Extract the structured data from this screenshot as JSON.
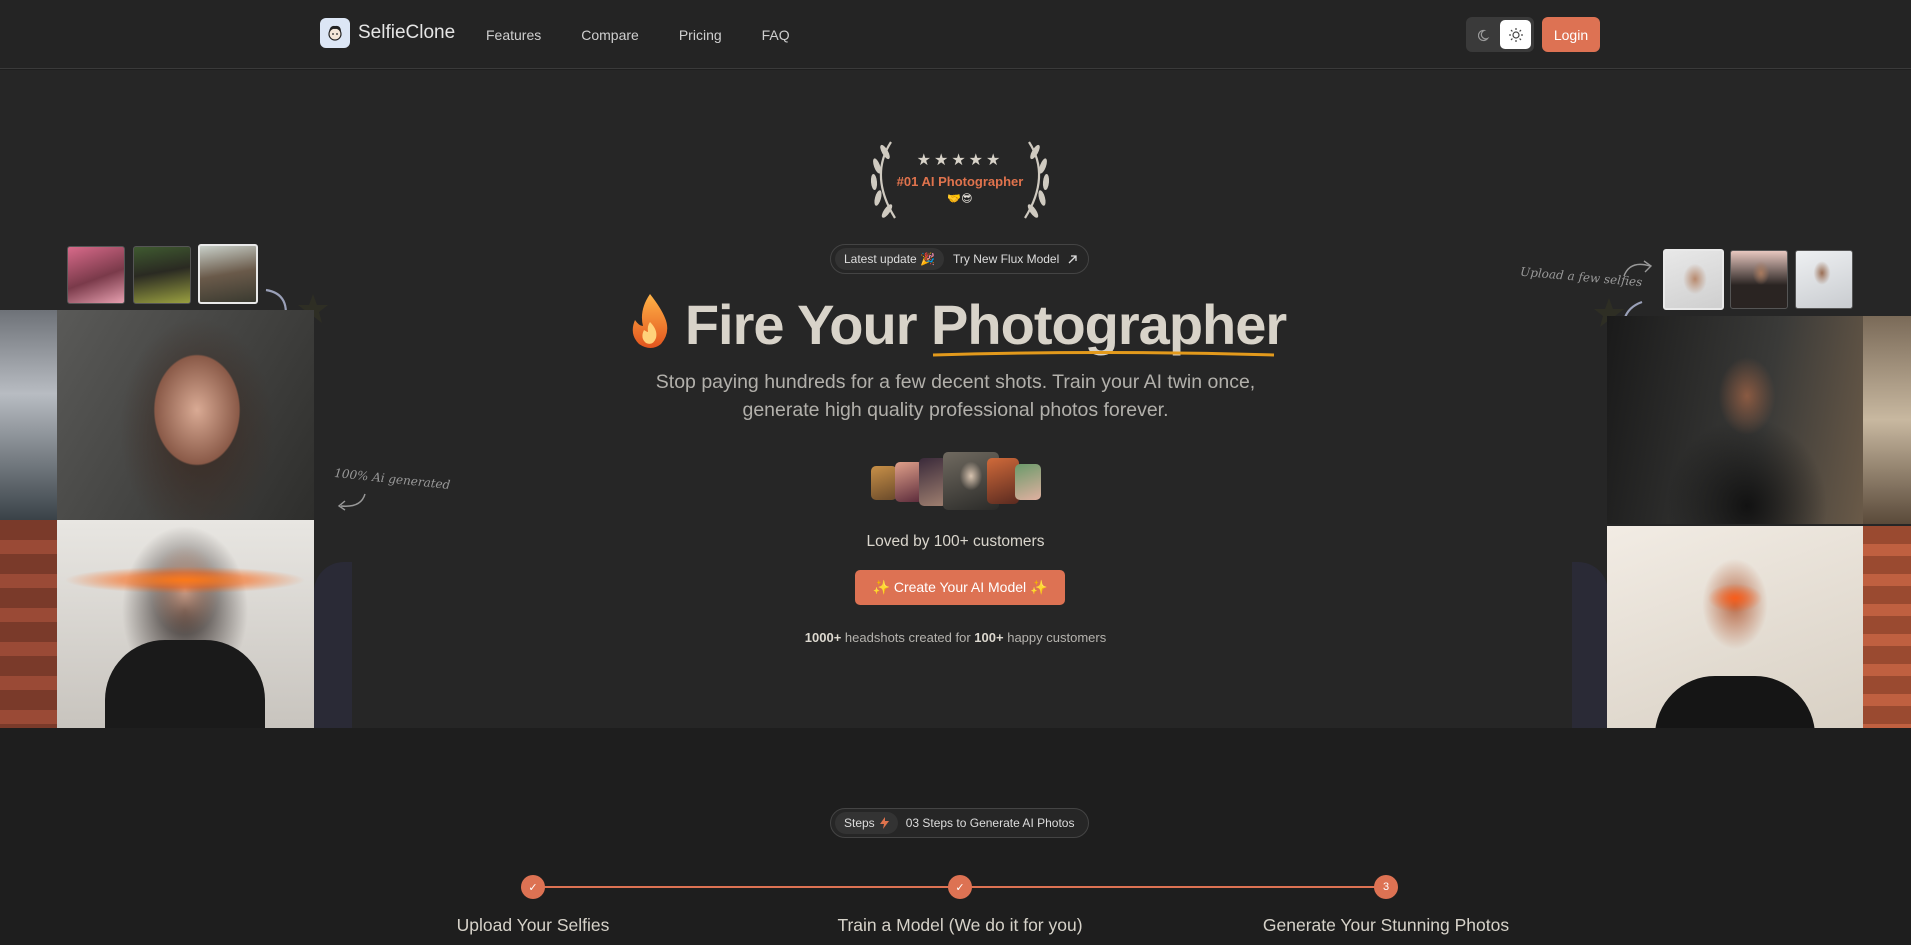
{
  "nav": {
    "brand": "SelfieClone",
    "links": [
      "Features",
      "Compare",
      "Pricing",
      "FAQ"
    ],
    "login": "Login"
  },
  "hero": {
    "award_stars": "★★★★★",
    "award_label": "#01 AI Photographer",
    "award_emoji": "🤝😎",
    "update_tag": "Latest update 🎉",
    "update_text": "Try New Flux Model",
    "title_part1": "Fire Your",
    "title_part2": "Photographer",
    "subtitle_line1": "Stop paying hundreds for a few decent shots. Train your AI twin once,",
    "subtitle_line2": "generate high quality professional photos forever.",
    "loved": "Loved by 100+ customers",
    "cta": "✨ Create Your AI Model ✨",
    "stats_num1": "1000+",
    "stats_mid": "headshots created for",
    "stats_num2": "100+",
    "stats_end": "happy customers",
    "note_left": "100% Ai generated",
    "note_right": "Upload a few selfies"
  },
  "steps": {
    "tag": "Steps",
    "text": "03 Steps to Generate AI Photos",
    "items": [
      {
        "label": "Upload Your Selfies",
        "marker": "✓"
      },
      {
        "label": "Train a Model (We do it for you)",
        "marker": "✓"
      },
      {
        "label": "Generate Your Stunning Photos",
        "marker": "3"
      }
    ]
  },
  "colors": {
    "accent": "#dd7253",
    "background": "#1e1e1e",
    "hero_bg": "#262626"
  }
}
